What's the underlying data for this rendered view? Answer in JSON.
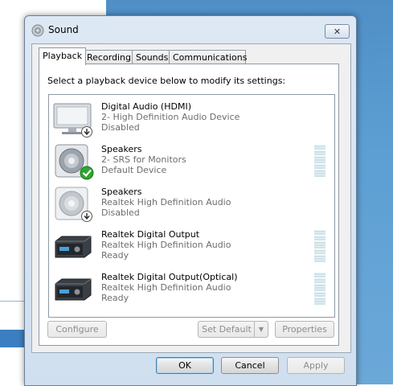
{
  "dialog": {
    "title": "Sound",
    "close_glyph": "✕",
    "icon": "speaker-icon"
  },
  "tabs": [
    {
      "label": "Playback",
      "active": true
    },
    {
      "label": "Recording",
      "active": false
    },
    {
      "label": "Sounds",
      "active": false
    },
    {
      "label": "Communications",
      "active": false
    }
  ],
  "panel": {
    "instruction": "Select a playback device below to modify its settings:"
  },
  "devices": [
    {
      "name": "Digital Audio (HDMI)",
      "description": "2- High Definition Audio Device",
      "status": "Disabled",
      "icon": "monitor-icon",
      "badge": "disabled-arrow-badge",
      "meter": false
    },
    {
      "name": "Speakers",
      "description": "2- SRS for Monitors",
      "status": "Default Device",
      "icon": "speaker-icon",
      "badge": "default-check-badge",
      "meter": true
    },
    {
      "name": "Speakers",
      "description": "Realtek High Definition Audio",
      "status": "Disabled",
      "icon": "speaker-icon",
      "badge": "disabled-arrow-badge",
      "meter": false
    },
    {
      "name": "Realtek Digital Output",
      "description": "Realtek High Definition Audio",
      "status": "Ready",
      "icon": "receiver-icon",
      "badge": "",
      "meter": true
    },
    {
      "name": "Realtek Digital Output(Optical)",
      "description": "Realtek High Definition Audio",
      "status": "Ready",
      "icon": "receiver-icon",
      "badge": "",
      "meter": true
    }
  ],
  "panel_buttons": {
    "configure": "Configure",
    "set_default": "Set Default",
    "properties": "Properties"
  },
  "footer_buttons": {
    "ok": "OK",
    "cancel": "Cancel",
    "apply": "Apply"
  },
  "colors": {
    "desktop": "#5d9fd3",
    "check": "#2fa52f",
    "meter": "#cfe3e8"
  }
}
